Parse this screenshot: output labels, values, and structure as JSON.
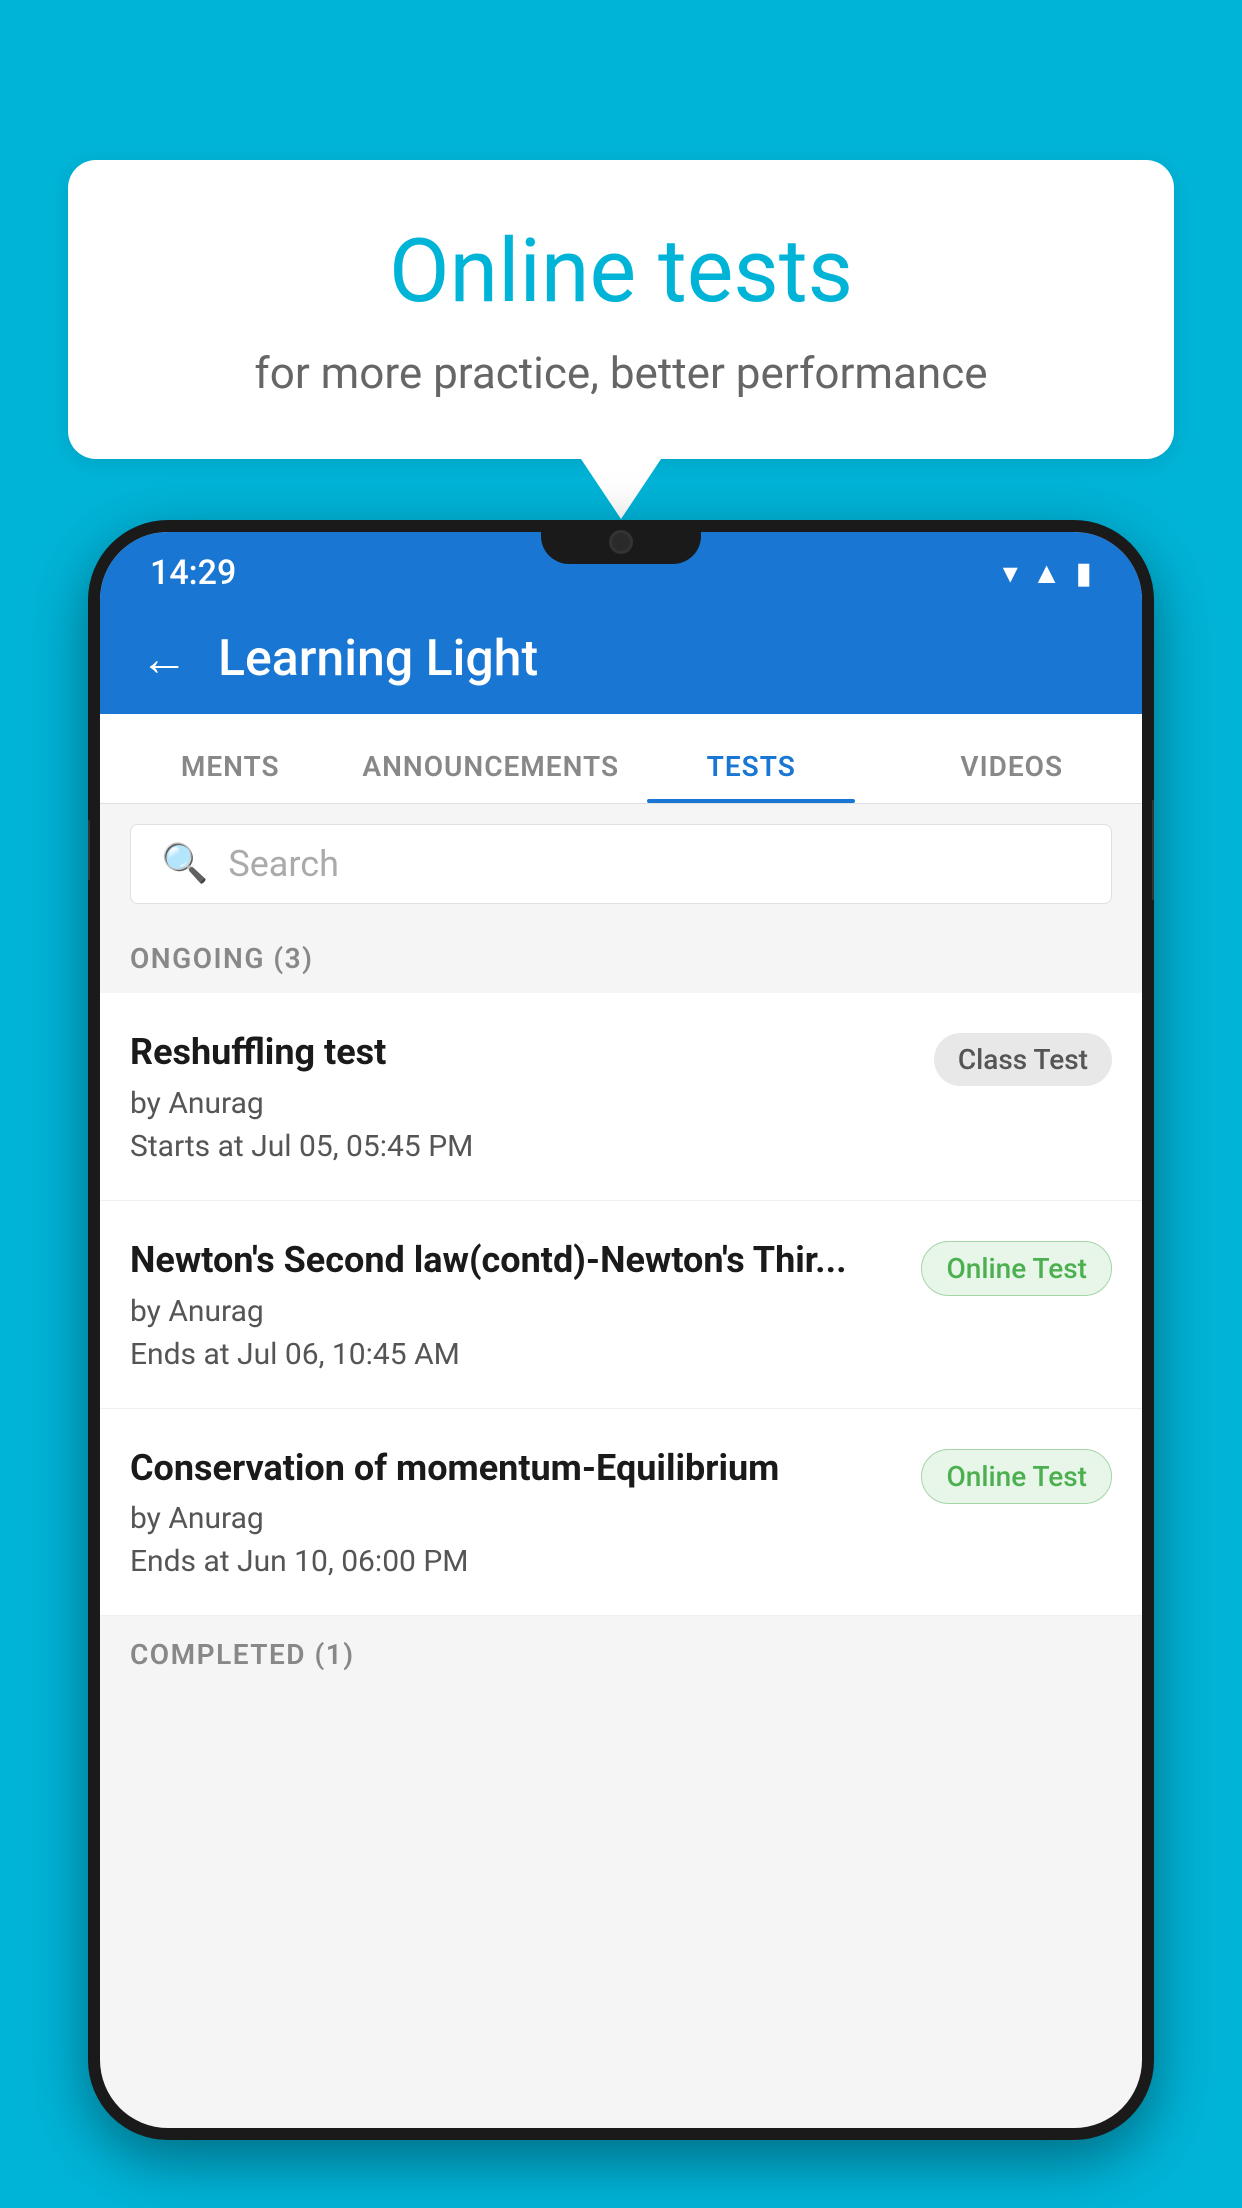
{
  "background_color": "#00B4D8",
  "speech_bubble": {
    "title": "Online tests",
    "subtitle": "for more practice, better performance"
  },
  "phone": {
    "status_bar": {
      "time": "14:29",
      "icons": [
        "wifi",
        "signal",
        "battery"
      ]
    },
    "header": {
      "back_label": "←",
      "title": "Learning Light"
    },
    "tabs": [
      {
        "label": "MENTS",
        "active": false
      },
      {
        "label": "ANNOUNCEMENTS",
        "active": false
      },
      {
        "label": "TESTS",
        "active": true
      },
      {
        "label": "VIDEOS",
        "active": false
      }
    ],
    "search": {
      "placeholder": "Search"
    },
    "sections": [
      {
        "header": "ONGOING (3)",
        "items": [
          {
            "name": "Reshuffling test",
            "author": "by Anurag",
            "time": "Starts at  Jul 05, 05:45 PM",
            "badge": "Class Test",
            "badge_type": "class"
          },
          {
            "name": "Newton's Second law(contd)-Newton's Thir...",
            "author": "by Anurag",
            "time": "Ends at  Jul 06, 10:45 AM",
            "badge": "Online Test",
            "badge_type": "online"
          },
          {
            "name": "Conservation of momentum-Equilibrium",
            "author": "by Anurag",
            "time": "Ends at  Jun 10, 06:00 PM",
            "badge": "Online Test",
            "badge_type": "online"
          }
        ]
      },
      {
        "header": "COMPLETED (1)",
        "items": []
      }
    ]
  }
}
